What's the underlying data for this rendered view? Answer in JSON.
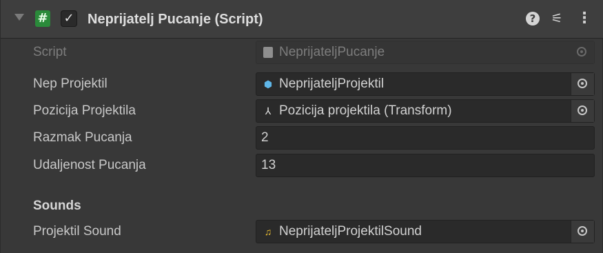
{
  "component": {
    "title": "Neprijatelj Pucanje (Script)",
    "enabled": true,
    "icons": {
      "foldout": "foldout-triangle-icon",
      "script": "csharp-script-icon",
      "help": "help-icon",
      "presets": "presets-icon",
      "menu": "kebab-menu-icon"
    },
    "script_icon_glyph": "#",
    "checkmark_glyph": "✓",
    "help_glyph": "?",
    "presets_glyph": "⚟",
    "menu_glyph": "⋮"
  },
  "fields": [
    {
      "label": "Script",
      "value": "NeprijateljPucanje",
      "type": "object",
      "icon": "script-asset-icon",
      "disabled": true
    },
    {
      "label": "Nep Projektil",
      "value": "NeprijateljProjektil",
      "type": "object",
      "icon": "prefab-icon",
      "disabled": false
    },
    {
      "label": "Pozicija Projektila",
      "value": "Pozicija projektila (Transform)",
      "type": "object",
      "icon": "transform-icon",
      "disabled": false
    },
    {
      "label": "Razmak Pucanja",
      "value": "2",
      "type": "number",
      "disabled": false
    },
    {
      "label": "Udaljenost Pucanja",
      "value": "13",
      "type": "number",
      "disabled": false
    }
  ],
  "sections": [
    {
      "header": "Sounds",
      "fields": [
        {
          "label": "Projektil Sound",
          "value": "NeprijateljProjektilSound",
          "type": "object",
          "icon": "audio-clip-icon",
          "disabled": false
        }
      ]
    }
  ],
  "glyphs": {
    "prefab": "⬢",
    "transform": "⅄",
    "audio": "♫"
  },
  "colors": {
    "panel_bg": "#383838",
    "header_bg": "#3e3e3e",
    "field_bg": "#2a2a2a",
    "script_icon_green": "#2a8a3a",
    "prefab_blue": "#5fb6e8",
    "audio_yellow": "#f1c232"
  }
}
